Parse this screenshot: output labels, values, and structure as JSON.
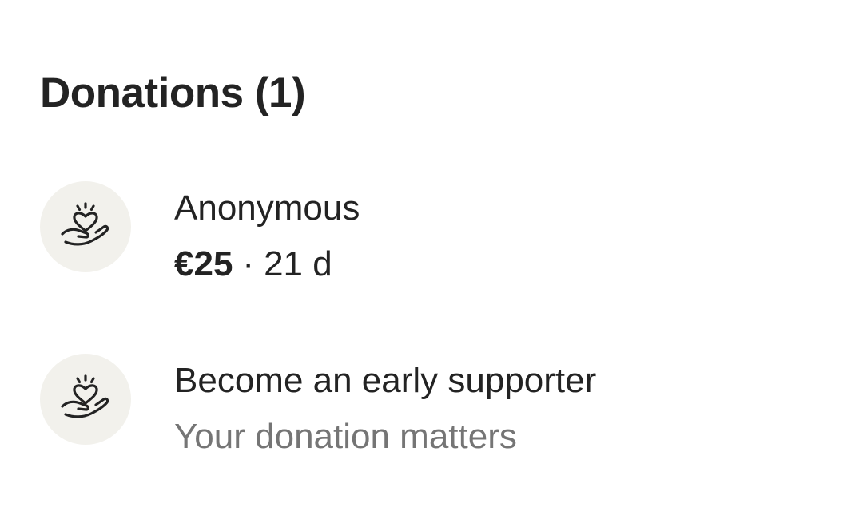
{
  "donations": {
    "title": "Donations (1)",
    "items": [
      {
        "icon": "donation-heart-hand-icon",
        "name": "Anonymous",
        "amount": "€25",
        "separator": "·",
        "time": "21 d"
      }
    ],
    "cta": {
      "icon": "donation-heart-hand-icon",
      "title": "Become an early supporter",
      "subtitle": "Your donation matters"
    }
  },
  "colors": {
    "text_primary": "#232323",
    "text_muted": "#757575",
    "avatar_bg": "#f2f1ec"
  }
}
